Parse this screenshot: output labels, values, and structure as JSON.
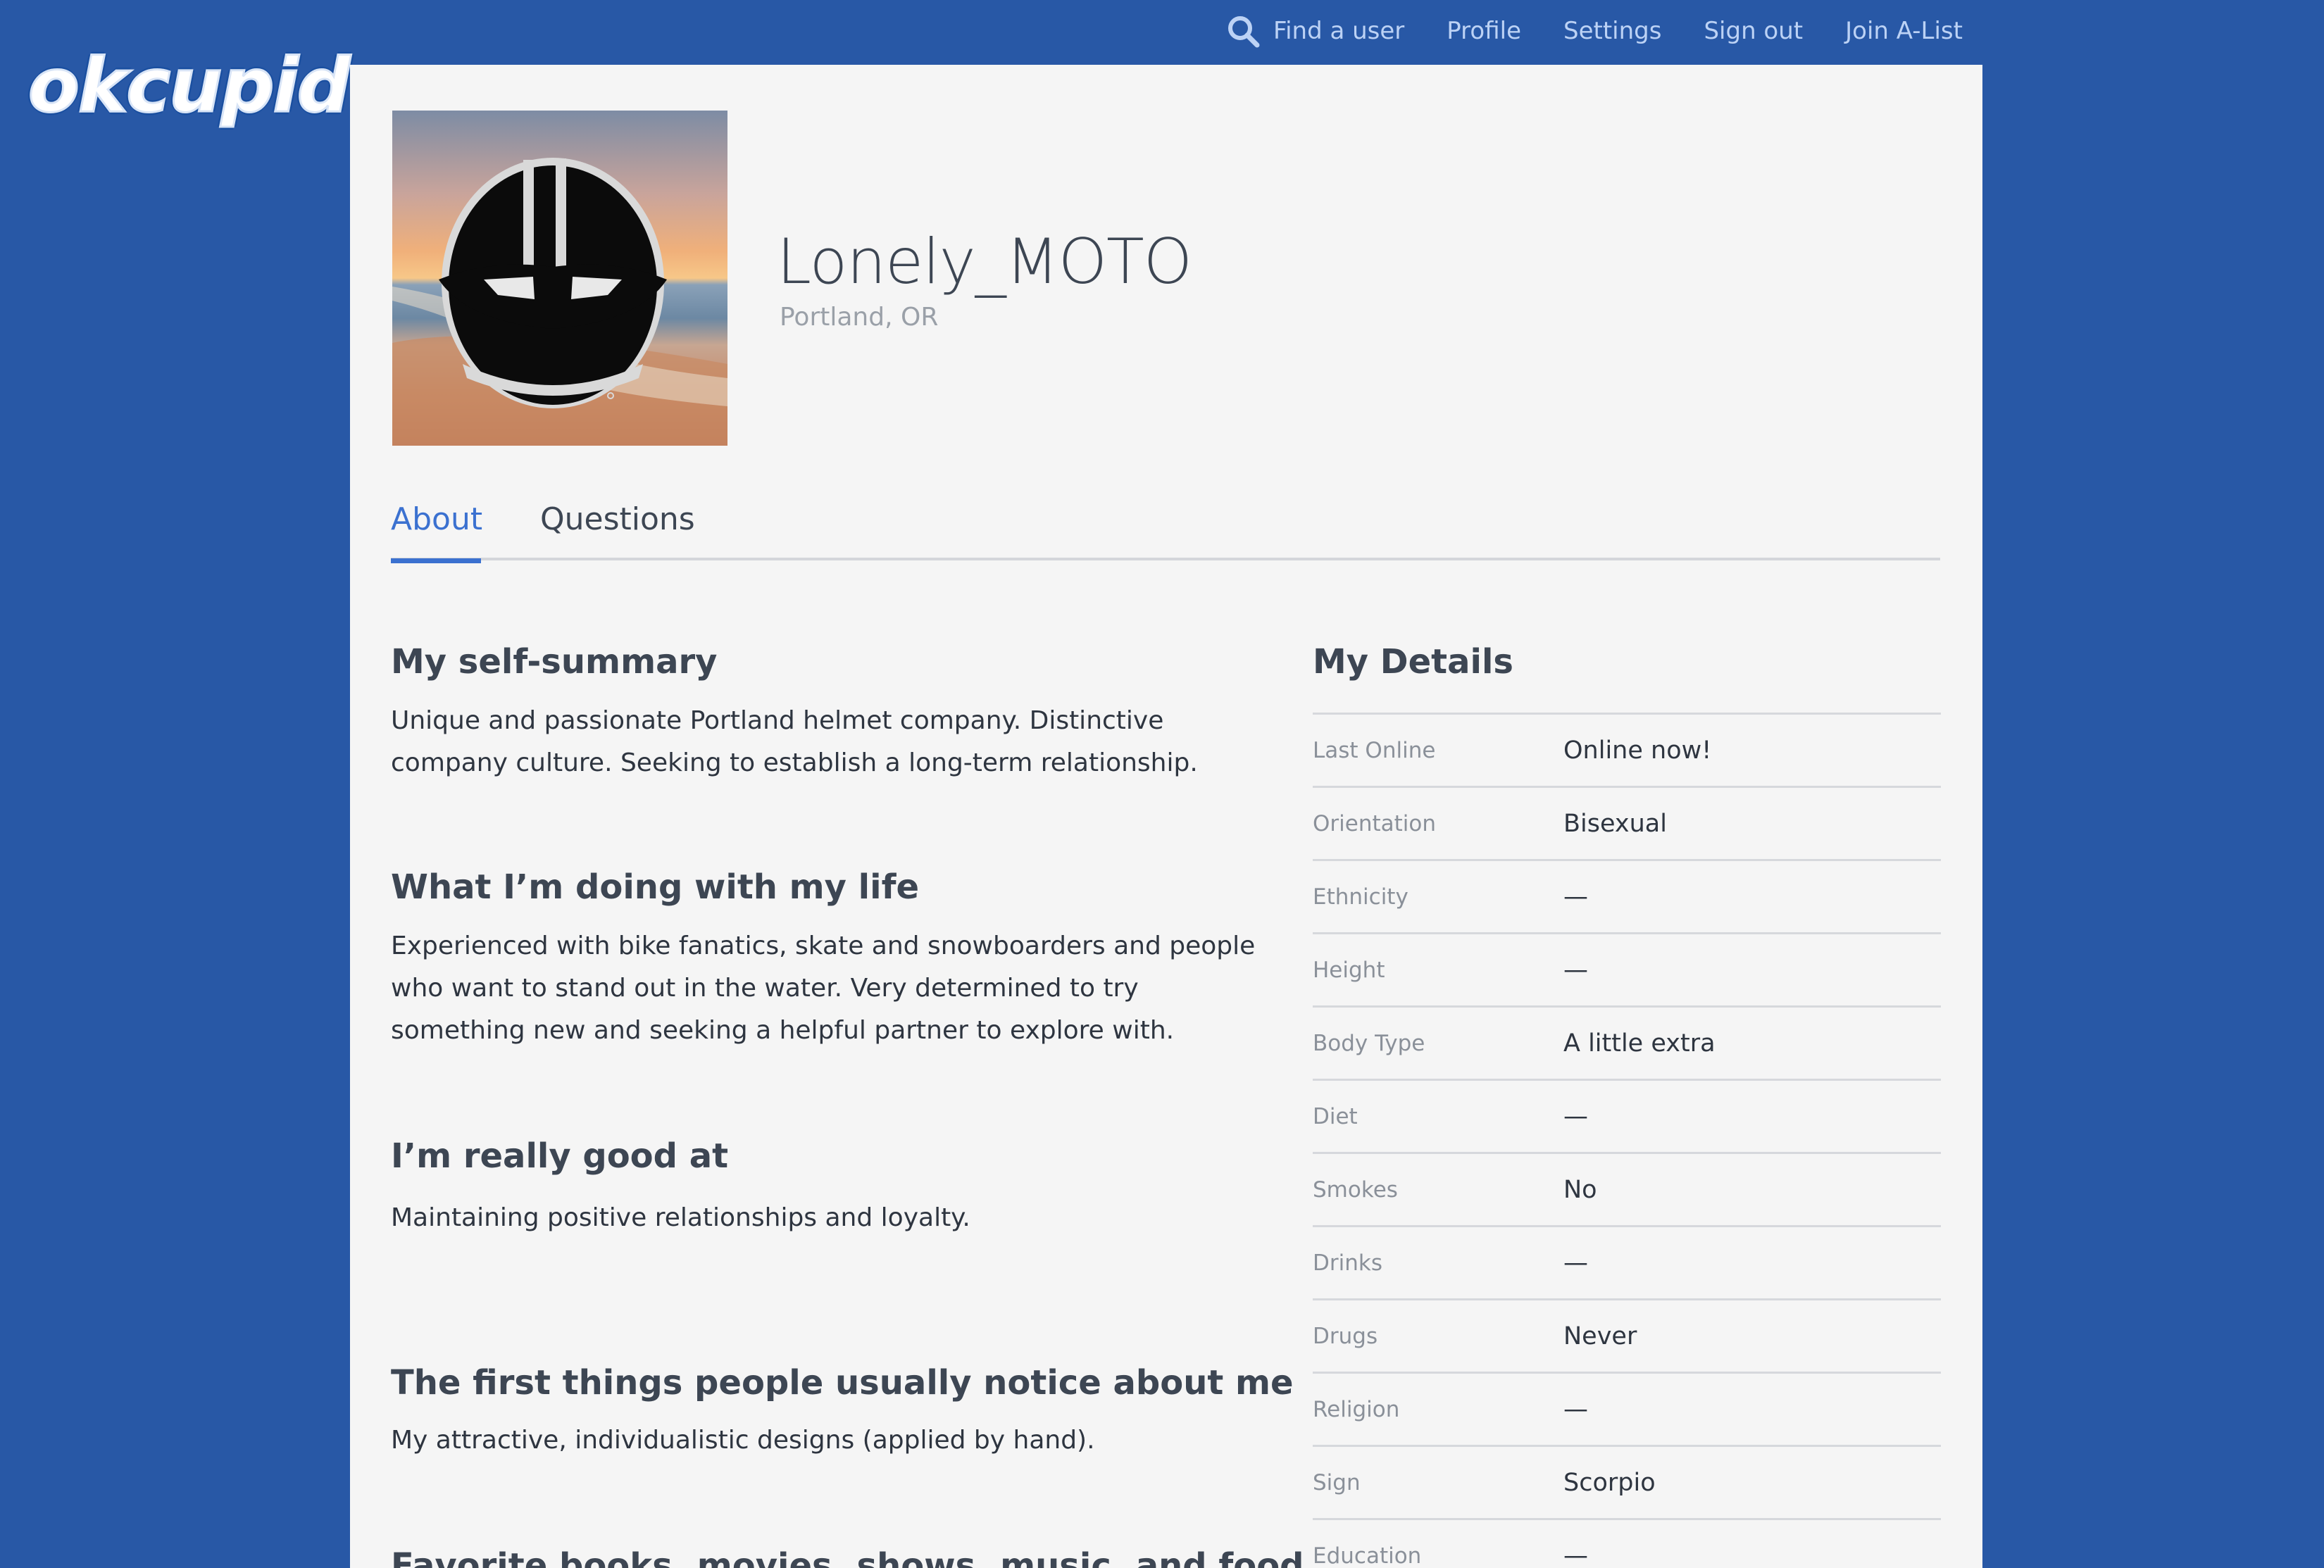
{
  "logo": {
    "text": "okcupid"
  },
  "nav": {
    "find_user": "Find a user",
    "profile": "Profile",
    "settings": "Settings",
    "sign_out": "Sign out",
    "join_alist": "Join A-List"
  },
  "profile": {
    "username": "Lonely_MOTO",
    "location": "Portland, OR"
  },
  "tabs": {
    "about": "About",
    "questions": "Questions",
    "active": "about"
  },
  "essays": {
    "self_summary": {
      "title": "My self-summary",
      "body": "Unique and passionate Portland helmet company. Distinctive company culture. Seeking to establish a long-term relationship."
    },
    "doing_with_life": {
      "title": "What I’m doing with my life",
      "body": "Experienced with bike fanatics, skate and snowboarders and people who want to stand out in the water. Very determined to try something new and seeking a helpful partner to explore with."
    },
    "good_at": {
      "title": "I’m really good at",
      "body": "Maintaining positive relationships and loyalty."
    },
    "first_things": {
      "title": "The first things people usually notice about me",
      "body": "My attractive, individualistic designs (applied by hand)."
    },
    "favorites": {
      "title": "Favorite books, movies, shows, music, and food"
    }
  },
  "details": {
    "title": "My Details",
    "rows": [
      {
        "label": "Last Online",
        "value": "Online now!"
      },
      {
        "label": "Orientation",
        "value": "Bisexual"
      },
      {
        "label": "Ethnicity",
        "value": "—"
      },
      {
        "label": "Height",
        "value": "—"
      },
      {
        "label": "Body Type",
        "value": "A little extra"
      },
      {
        "label": "Diet",
        "value": "—"
      },
      {
        "label": "Smokes",
        "value": "No"
      },
      {
        "label": "Drinks",
        "value": "—"
      },
      {
        "label": "Drugs",
        "value": "Never"
      },
      {
        "label": "Religion",
        "value": "—"
      },
      {
        "label": "Sign",
        "value": "Scorpio"
      },
      {
        "label": "Education",
        "value": "—"
      }
    ]
  },
  "colors": {
    "background": "#2858a6",
    "card": "#f5f5f5",
    "accent": "#3b71d0",
    "nav_text": "#bcd2f5"
  }
}
